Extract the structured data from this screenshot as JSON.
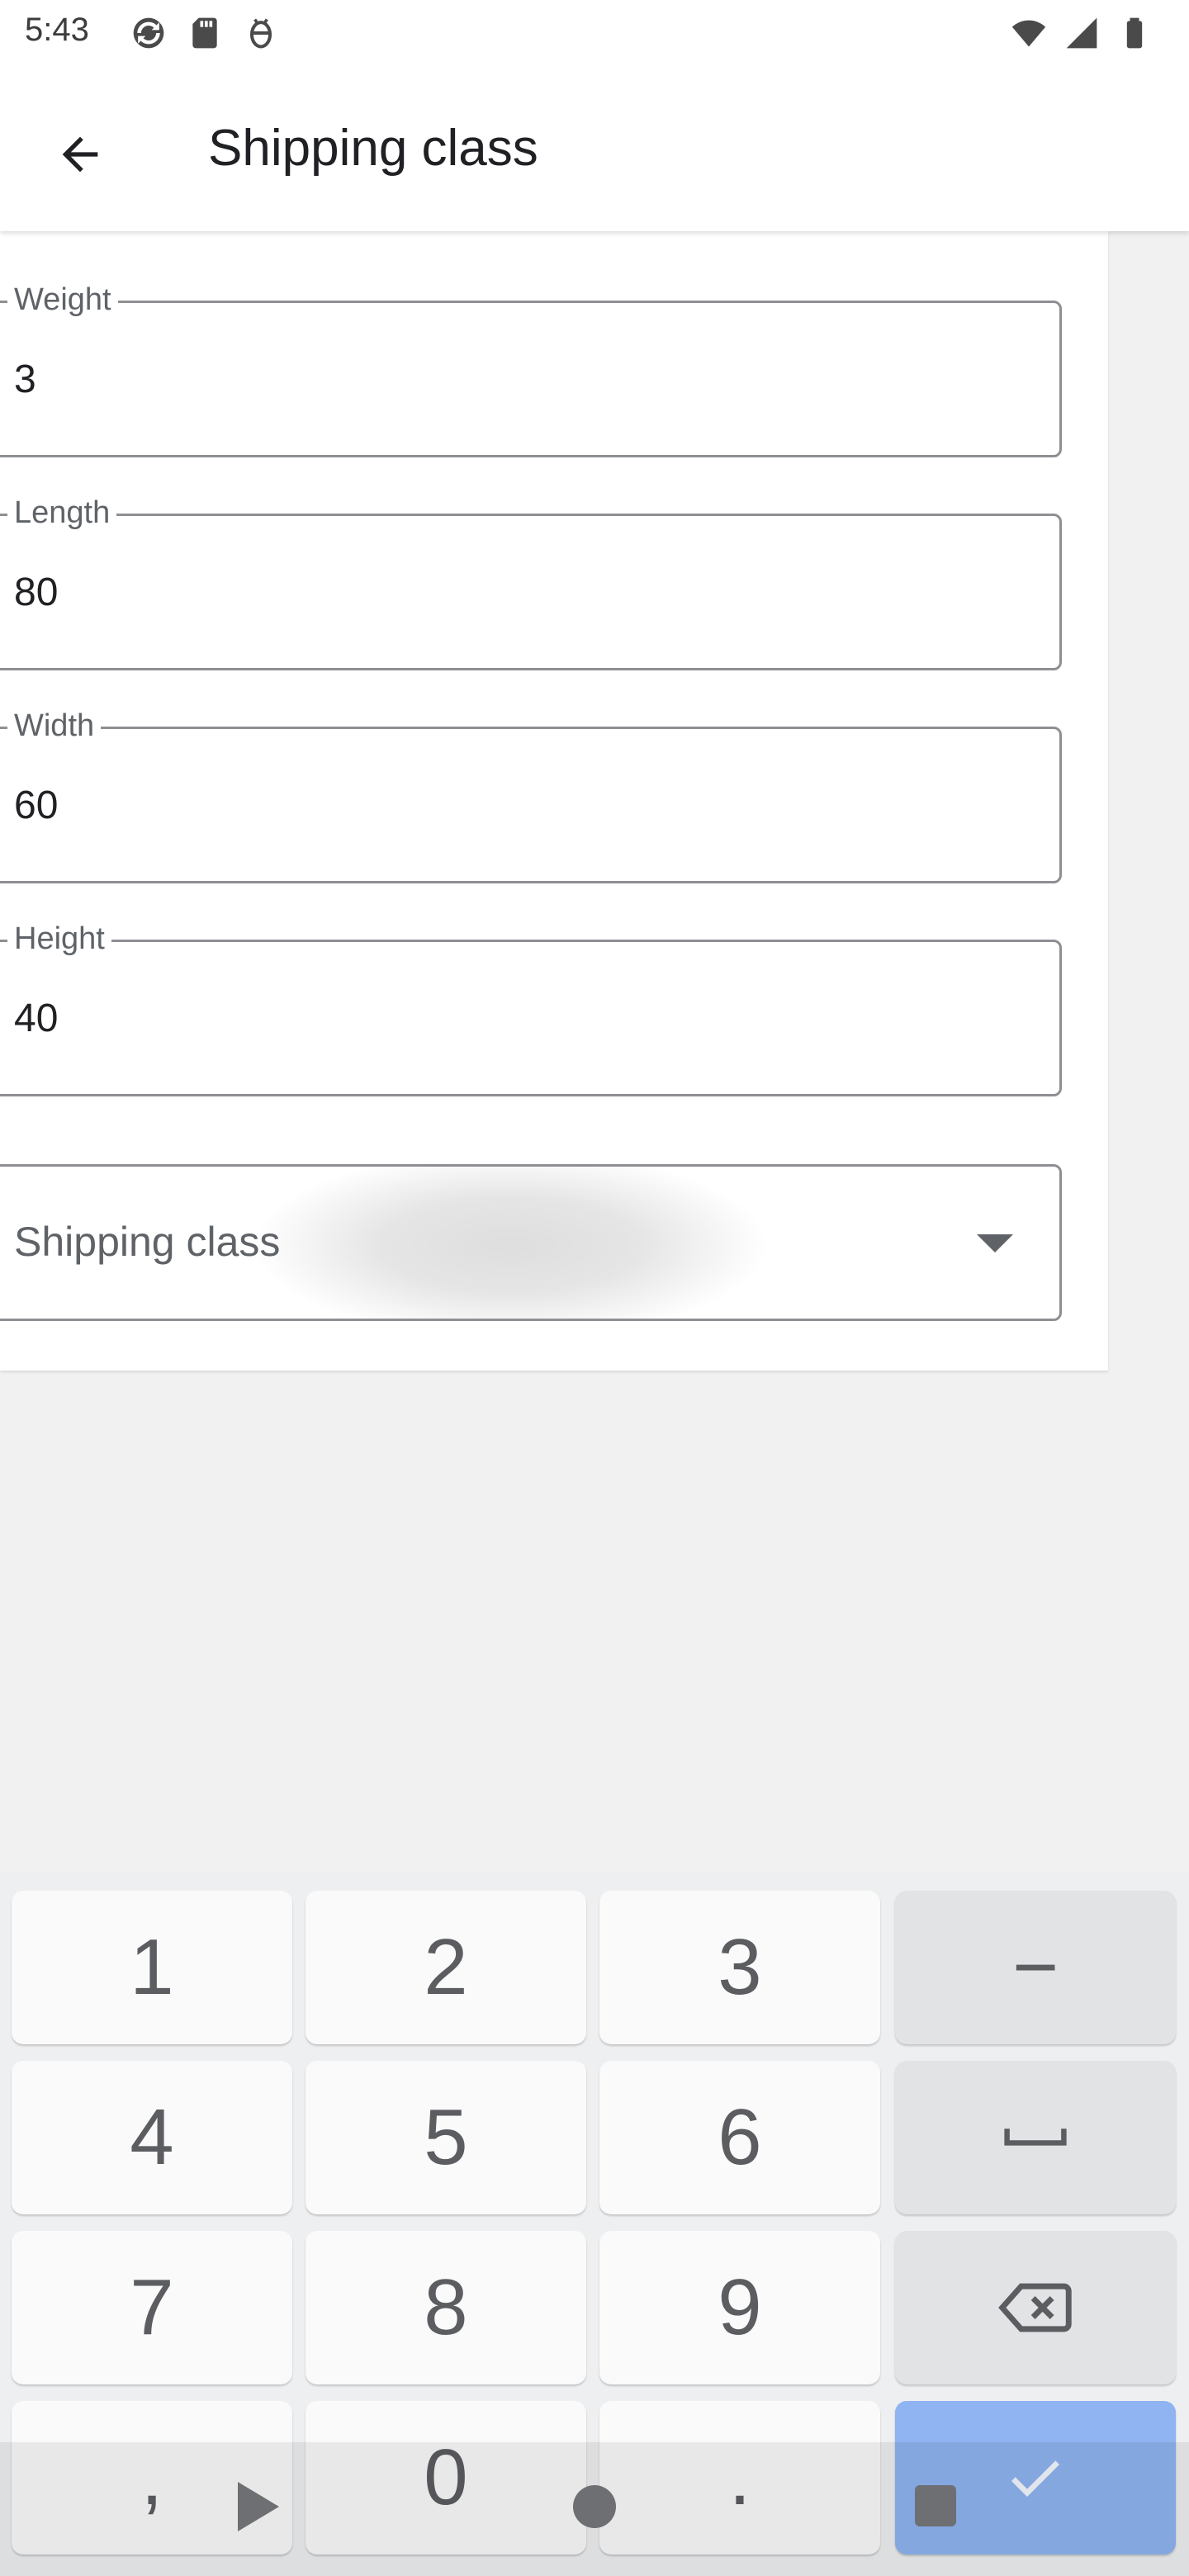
{
  "status_bar": {
    "time": "5:43",
    "left_icons": [
      "sync-icon",
      "sd-card-icon",
      "debug-icon"
    ],
    "right_icons": [
      "wifi-icon",
      "cell-signal-icon",
      "battery-icon"
    ]
  },
  "app_bar": {
    "title": "Shipping class",
    "back_icon": "arrow-back-icon"
  },
  "form": {
    "weight": {
      "label": "Weight",
      "value": "3"
    },
    "length": {
      "label": "Length",
      "value": "80"
    },
    "width": {
      "label": "Width",
      "value": "60"
    },
    "height": {
      "label": "Height",
      "value": "40"
    },
    "shipping_class": {
      "placeholder": "Shipping class",
      "icon": "dropdown-arrow-icon"
    }
  },
  "keyboard": {
    "row1": [
      "1",
      "2",
      "3",
      "−"
    ],
    "row2": [
      "4",
      "5",
      "6"
    ],
    "row3": [
      "7",
      "8",
      "9"
    ],
    "row4": [
      ",",
      "0",
      "."
    ],
    "space_icon": "space-icon",
    "backspace_icon": "backspace-icon",
    "enter_icon": "checkmark-icon"
  },
  "nav_bar": {
    "icons": [
      "nav-back-icon",
      "nav-home-icon",
      "nav-recents-icon"
    ]
  },
  "colors": {
    "accent_key": "#8fb4f1",
    "text_primary": "#202124",
    "outline": "#8d8f93"
  }
}
